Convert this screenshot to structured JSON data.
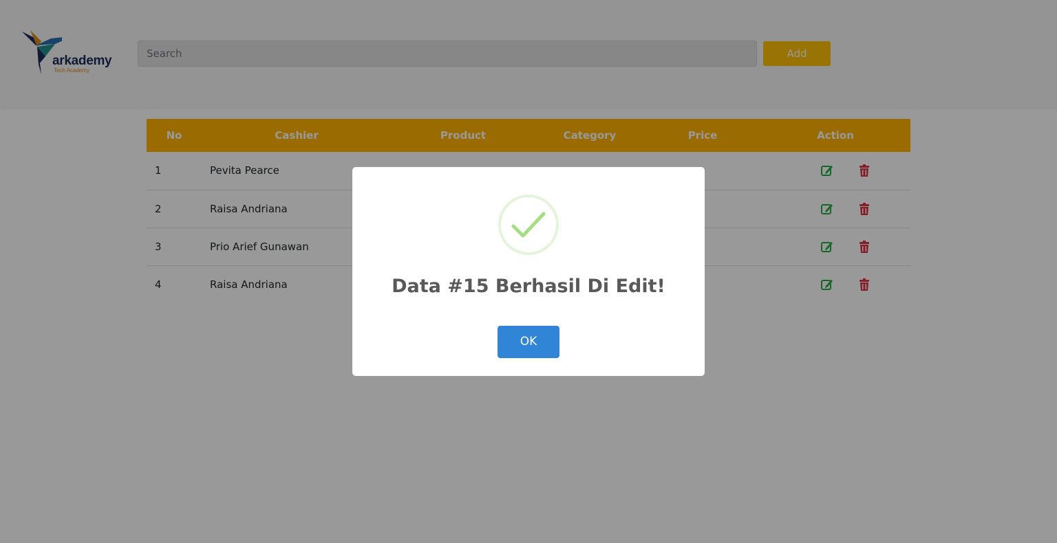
{
  "header": {
    "logo_text": "arkademy",
    "logo_subtext": "Tech Academy",
    "search_placeholder": "Search",
    "add_label": "Add"
  },
  "table": {
    "columns": [
      "No",
      "Cashier",
      "Product",
      "Category",
      "Price",
      "Action"
    ],
    "rows": [
      {
        "no": "1",
        "cashier": "Pevita Pearce"
      },
      {
        "no": "2",
        "cashier": "Raisa Andriana"
      },
      {
        "no": "3",
        "cashier": "Prio Arief Gunawan"
      },
      {
        "no": "4",
        "cashier": "Raisa Andriana"
      }
    ]
  },
  "modal": {
    "title": "Data #15 Berhasil Di Edit!",
    "ok_label": "OK",
    "icon": "success-check-icon"
  },
  "colors": {
    "accent": "#ffc107",
    "table_header": "#ffb300",
    "edit": "#28a745",
    "delete": "#dc3545",
    "confirm": "#3085d6",
    "success": "#a5dc86"
  }
}
